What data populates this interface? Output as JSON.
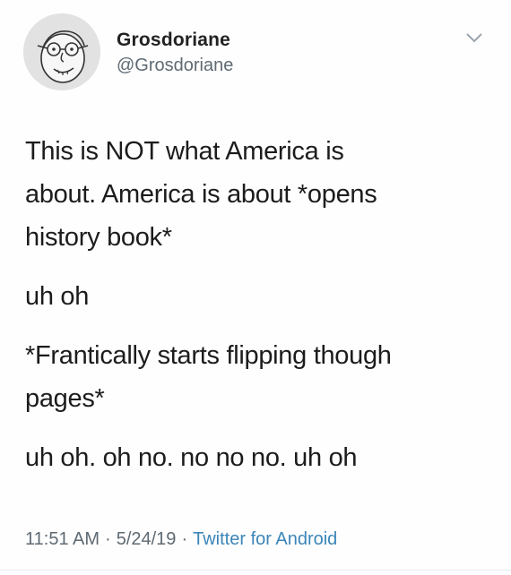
{
  "author": {
    "display_name": "Grosdoriane",
    "handle": "@Grosdoriane",
    "avatar_icon": "cartoon-face-avatar-icon"
  },
  "menu": {
    "icon": "chevron-down-icon"
  },
  "tweet": {
    "line1": "This is NOT what America is",
    "line2": "about. America is about *opens",
    "line3": "history book*",
    "line4": "uh oh",
    "line5": "*Frantically starts flipping though",
    "line6": "pages*",
    "line7": "uh oh. oh no. no no no. uh oh"
  },
  "meta": {
    "time": "11:51 AM",
    "separator": "·",
    "date": "5/24/19",
    "client": "Twitter for Android"
  },
  "colors": {
    "text": "#1c1c1c",
    "secondary": "#5f6a73",
    "link": "#3b85b8"
  }
}
